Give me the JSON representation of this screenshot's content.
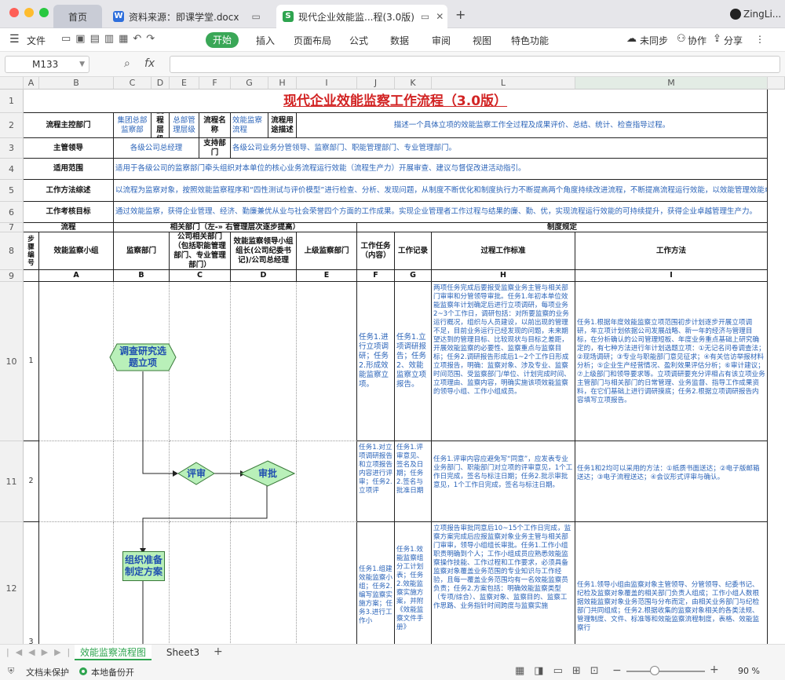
{
  "tabs": {
    "home": "首页",
    "doc": "资料来源：即课学堂.docx",
    "sheet": "现代企业效能监...程(3.0版)",
    "user": "ZingLi..."
  },
  "menu": {
    "file": "文件",
    "items": [
      "开始",
      "插入",
      "页面布局",
      "公式",
      "数据",
      "审阅",
      "视图",
      "特色功能"
    ],
    "sync": "未同步",
    "collab": "协作",
    "share": "分享"
  },
  "formula": {
    "cellref": "M133",
    "fx": "fx"
  },
  "cols": [
    "A",
    "B",
    "C",
    "D",
    "E",
    "F",
    "G",
    "H",
    "I",
    "J",
    "K",
    "L",
    "M"
  ],
  "rows": [
    "1",
    "2",
    "3",
    "4",
    "5",
    "6",
    "7",
    "8",
    "9",
    "10",
    "11",
    "12"
  ],
  "sheet": {
    "title": "现代企业效能监察工作流程（3.0版）",
    "r2": {
      "label": "流程主控部门",
      "dept": "集团总部监察部",
      "level_label": "流程层级",
      "level": "总部管理层级",
      "name_label": "流程名称",
      "name": "效能监察流程",
      "use_label": "流程用途描述",
      "use": "描述一个具体立项的效能监察工作全过程及成果评价、总结、统计、检查指导过程。"
    },
    "r3": {
      "label": "主管领导",
      "leader": "各级公司总经理",
      "support_label": "支持部门",
      "support": "各级公司业务分管领导、监察部门、职能管理部门、专业管理部门。"
    },
    "r4": {
      "label": "适用范围",
      "text": "适用于各级公司的监察部门牵头组织对本单位的核心业务流程运行效能（流程生产力）开展审查、建议与督促改进活动指引。"
    },
    "r5": {
      "label": "工作方法综述",
      "text": "以流程为监察对象，按照效能监察程序和“四性测试与评价模型”进行检查、分析、发现问题，从制度不断优化和制度执行力不断提高两个角度持续改进流程，不断提高流程运行效能，以效能管理效能卓越"
    },
    "r6": {
      "label": "工作考核目标",
      "text": "通过效能监察，获得企业管理、经济、勤廉兼优从业与社会荣誉四个方面的工作成果。实现企业管理者工作过程与结果的廉、勤、优，实现流程运行效能的可持续提升，获得企业卓越管理生产力。"
    },
    "r7": {
      "flow": "流程",
      "related": "相关部门（左-» 右管理层次逐步提高）",
      "system": "制度规定"
    },
    "r8": {
      "step": "步骤编号",
      "team": "效能监察小组",
      "dept": "监察部门",
      "related": "公司相关部门（包括职能管理部门、专业管理部门）",
      "leader": "效能监察领导小组组长(公司纪委书记)/公司总经理",
      "upper": "上级监察部门",
      "task": "工作任务（内容）",
      "record": "工作记录",
      "standard": "过程工作标准",
      "method": "工作方法"
    },
    "r9": [
      "A",
      "B",
      "C",
      "D",
      "E",
      "F",
      "G",
      "H",
      "I"
    ],
    "r10": {
      "num": "1",
      "task": "任务1.进行立项调研；任务2.形成效能监察立项。",
      "record": "任务1.立项调研报告；任务2、效能监察立项报告。",
      "standard": "两项任务完成后要报受监察业务主管与相关部门审审和分管领导审批。任务1.年初本单位效能监察年计划确定后进行立项调研，每项业务2~3个工作日，调研包括：对所要监察的业务运行概况，组织与人员建设，以前出现的管理不足，目前业务运行已经发现的问题，未来期望达到的管理目标、比较现状与目标之差距，开展效能监察的必要性、监察重点与监察目标；任务2.调研报告形成后1~2个工作日形成立项报告，明确：监察对象、涉及专业、监察时间范围、受监察部门/单位、计划完成时间、立项理由、监察内容，明确实施该项效能监察的领导小组、工作小组成员。",
      "method": "任务1.根据年度效能监察立项范围初步计划逐步开展立项调研，年立项计划依据公司发展战略、新一年的经济与管理目标，在分析确认的公司管理短板、年度业务重点基础上研究确定的，有七种方法进行年计划选题立项：①无记名问卷调查法；②现场调研；③专业与职能部门意见征求；④有关信访举报材料分析；⑤企业生产经营情况、盈利效果评估分析；⑥审计建议；⑦上级部门和领导要求等。立项调研要充分评相占有该立项业务主管部门与相关部门的日常管理、业务监督、指导工作成果资料，在它们基础上进行调研摸底；任务2.根据立项调研报告内容填写立项报告。"
    },
    "r11": {
      "num": "2",
      "task": "任务1.对立项调研报告和立项报告内容进行评审；任务2.立项评",
      "record": "任务1.评审意见、签名及日期；任务2.签名与批准日期",
      "standard": "任务1.评审内容应避免写“同意”，应发表专业业务部门、职能部门对立项的评审意见，1个工作日完成，签名与标注日期；任务2.批示审批意见，1个工作日完成，签名与标注日期。",
      "method": "任务1和2均可以采用的方法：①纸质书面送达；②电子版邮箱送达；③电子流程送达；④会议形式评审与确认。"
    },
    "r12": {
      "num": "3",
      "task": "任务1.组建效能监察小组；任务2.编写监察实施方案；任务3.进行工作小",
      "record": "任务1.效能监察组分工计划表；任务2.效能监察实施方案，并附《效能监察文件手册》",
      "standard": "立项报告审批同意后10~15个工作日完成，监察方案完成后应报监察对象业务主管与相关部门审审，领导小组组长审批。任务1.工作小组职责明确到个人；工作小组成员应熟悉效能监察操作技能、工作过程和工作要求，必须具备监察对象覆盖业务范围的专业知识与工作经验，且每一覆盖业务范围均有一名效能监察员负责；任务2.方案包括：明确效能监察类型（专项/综合）、监察对象、监察目的、监察工作思路、业务指针时间跨度与监察实施",
      "method": "任务1.领导小组由监察对象主管领导、分管领导、纪委书记、纪检及监察对象覆盖的相关部门负责人组成；工作小组人数根据效能监察对象业务范围与分布而定，由相关业务部门与纪检部门共同组成；任务2.根据收集的监察对象相关的各类法规、管理制度、文件、标准等和效能监察流程制度，表格、效能监察行"
    },
    "shapes": {
      "s1": "调查研究选题立项",
      "s2": "评审",
      "s3": "审批",
      "s4": "组织准备制定方案"
    }
  },
  "sheettabs": {
    "active": "效能监察流程图",
    "other": "Sheet3"
  },
  "status": {
    "protect": "文档未保护",
    "backup": "本地备份开",
    "zoom": "90 %"
  },
  "colors": {
    "accent": "#3aa757",
    "title": "#d22424",
    "text_blue": "#2a63b8",
    "shape_fill": "#b9f0b9"
  }
}
